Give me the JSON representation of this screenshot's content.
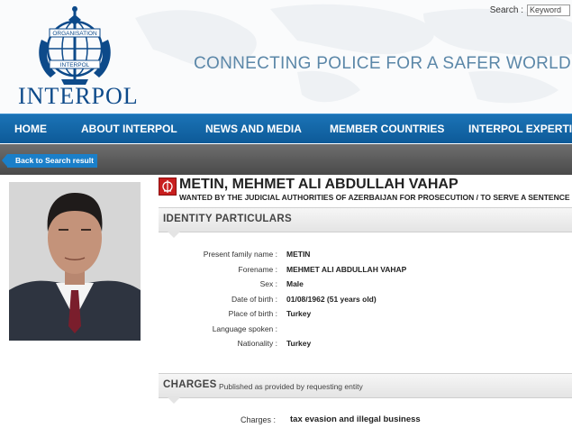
{
  "header": {
    "logo_text": "INTERPOL",
    "logo_emblem_text": [
      "ORGANISATION",
      "INTERPOL"
    ],
    "tagline": "CONNECTING POLICE FOR A SAFER WORLD",
    "search": {
      "label": "Search :",
      "value": "Keyword"
    },
    "brand_color": "#0d4a8a"
  },
  "nav": {
    "items": [
      {
        "label": "HOME"
      },
      {
        "label": "ABOUT INTERPOL"
      },
      {
        "label": "NEWS AND MEDIA"
      },
      {
        "label": "MEMBER COUNTRIES"
      },
      {
        "label": "INTERPOL EXPERTISE"
      }
    ],
    "color": "#0d5a98"
  },
  "back_button": "Back to Search result",
  "notice": {
    "name": "METIN, MEHMET ALI ABDULLAH VAHAP",
    "wanted_text": "WANTED BY THE JUDICIAL AUTHORITIES OF AZERBAIJAN FOR PROSECUTION / TO SERVE A SENTENCE",
    "notice_color": "#c81e1e"
  },
  "identity": {
    "title": "IDENTITY PARTICULARS",
    "rows": [
      {
        "label": "Present family name :",
        "value": "METIN"
      },
      {
        "label": "Forename :",
        "value": "MEHMET ALI ABDULLAH VAHAP"
      },
      {
        "label": "Sex :",
        "value": "Male"
      },
      {
        "label": "Date of birth :",
        "value": "01/08/1962 (51 years old)"
      },
      {
        "label": "Place of birth :",
        "value": "Turkey"
      },
      {
        "label": "Language spoken :",
        "value": ""
      },
      {
        "label": "Nationality :",
        "value": "Turkey"
      }
    ]
  },
  "charges": {
    "title": "CHARGES",
    "subtitle": "Published as provided by requesting entity",
    "label": "Charges :",
    "value": "tax evasion and illegal business"
  }
}
